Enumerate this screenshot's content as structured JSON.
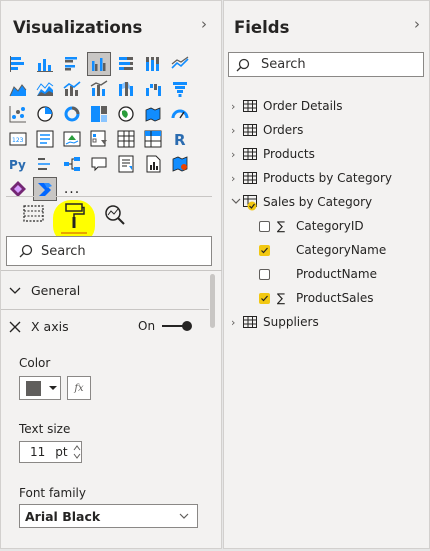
{
  "viz": {
    "title": "Visualizations",
    "search_placeholder": "Search",
    "sections": {
      "general": "General",
      "x_axis": "X axis"
    },
    "x_axis_toggle": {
      "label": "On",
      "on": true
    },
    "color_label": "Color",
    "fx_label": "fx",
    "color_value": "#605e5c",
    "text_size_label": "Text size",
    "text_size_value": "11",
    "text_size_unit": "pt",
    "font_family_label": "Font family",
    "font_family_value": "Arial Black",
    "more_label": "...",
    "tabs": [
      "build-visual",
      "format-visual",
      "analytics"
    ]
  },
  "fields": {
    "title": "Fields",
    "search_placeholder": "Search",
    "tables": [
      {
        "name": "Order Details",
        "expanded": false
      },
      {
        "name": "Orders",
        "expanded": false
      },
      {
        "name": "Products",
        "expanded": false
      },
      {
        "name": "Products by Category",
        "expanded": false
      },
      {
        "name": "Sales by Category",
        "expanded": true,
        "fields": [
          {
            "name": "CategoryID",
            "checked": false,
            "sigma": true
          },
          {
            "name": "CategoryName",
            "checked": true,
            "sigma": false
          },
          {
            "name": "ProductName",
            "checked": false,
            "sigma": false
          },
          {
            "name": "ProductSales",
            "checked": true,
            "sigma": true
          }
        ]
      },
      {
        "name": "Suppliers",
        "expanded": false
      }
    ]
  },
  "colors": {
    "accent": "#f2c811",
    "highlight": "#ffff00",
    "pane_bg": "#f3f2f1"
  }
}
